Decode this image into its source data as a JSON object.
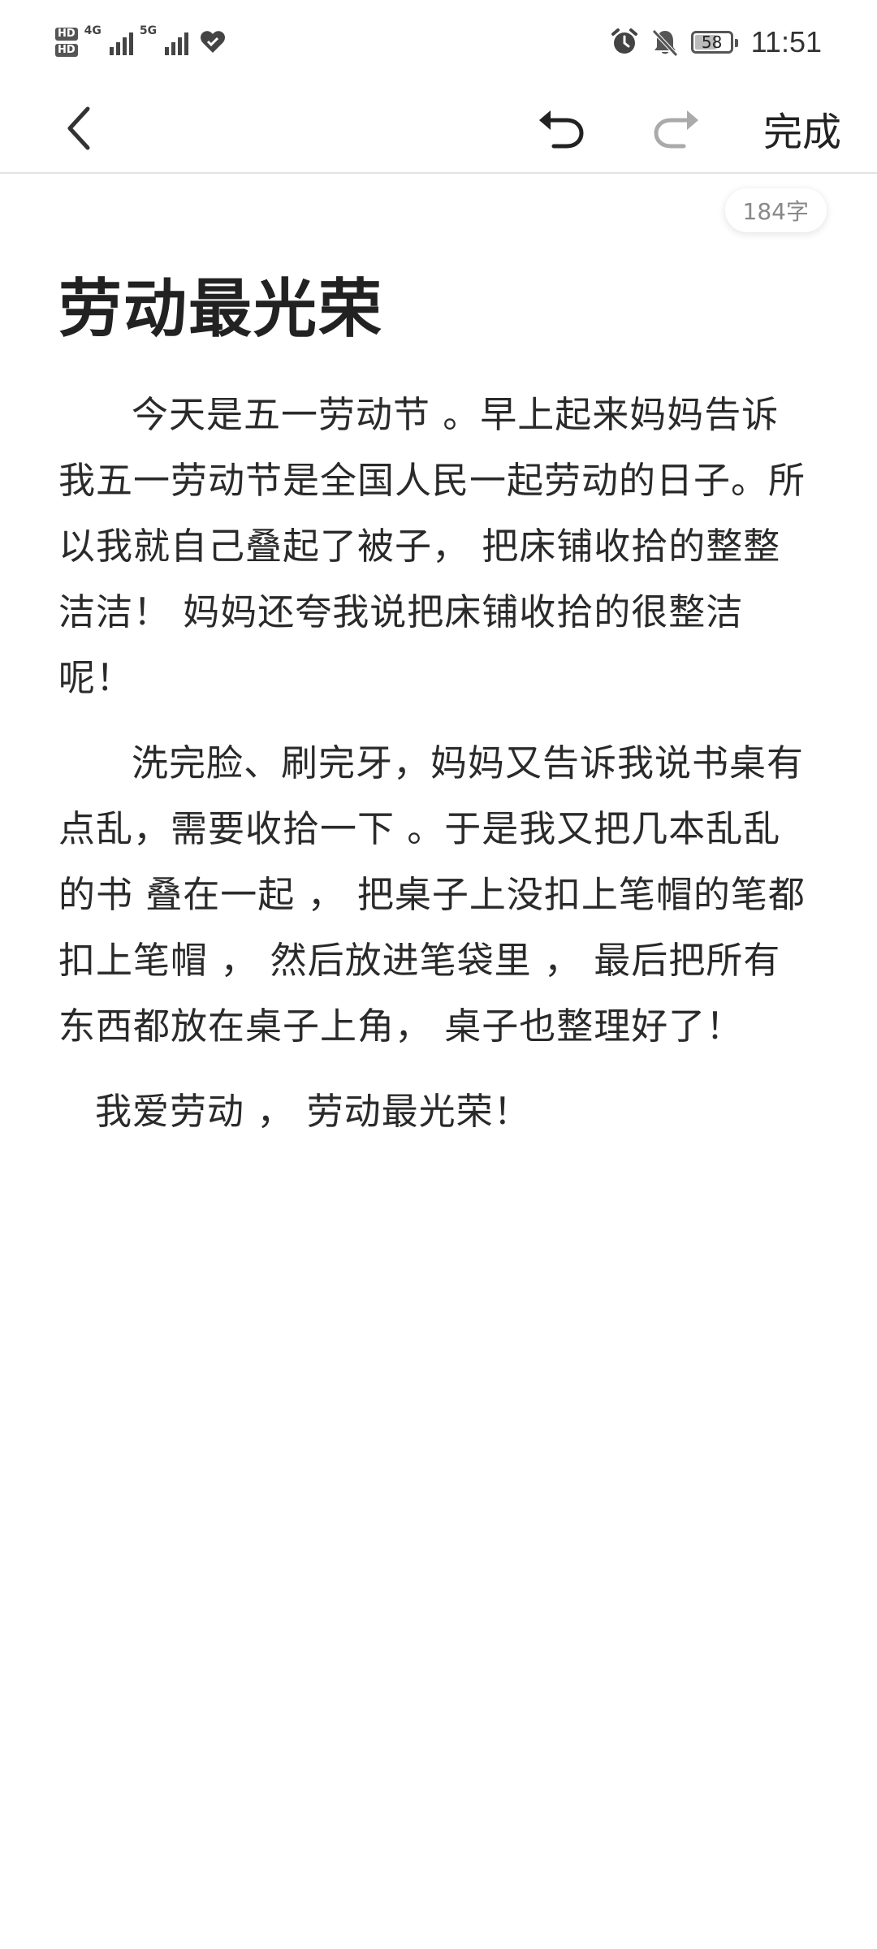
{
  "status_bar": {
    "hd_top": "HD",
    "hd_bottom": "HD",
    "net1": "4G",
    "net2": "5G",
    "battery": "58",
    "time": "11:51",
    "icons": [
      "heart-icon",
      "alarm-icon",
      "bell-off-icon"
    ]
  },
  "toolbar": {
    "done_label": "完成",
    "undo_icon": "undo-icon",
    "redo_icon": "redo-icon",
    "back_icon": "chevron-left-icon"
  },
  "word_count": "184字",
  "note": {
    "title": "劳动最光荣",
    "paragraphs": [
      "今天是五一劳动节 。早上起来妈妈告诉我五一劳动节是全国人民一起劳动的日子。所以我就自己叠起了被子， 把床铺收拾的整整洁洁！ 妈妈还夸我说把床铺收拾的很整洁呢！",
      "洗完脸、刷完牙，妈妈又告诉我说书桌有点乱，需要收拾一下 。于是我又把几本乱乱的书 叠在一起 ， 把桌子上没扣上笔帽的笔都扣上笔帽 ， 然后放进笔袋里 ， 最后把所有东西都放在桌子上角， 桌子也整理好了！",
      "我爱劳动 ， 劳动最光荣！"
    ]
  }
}
